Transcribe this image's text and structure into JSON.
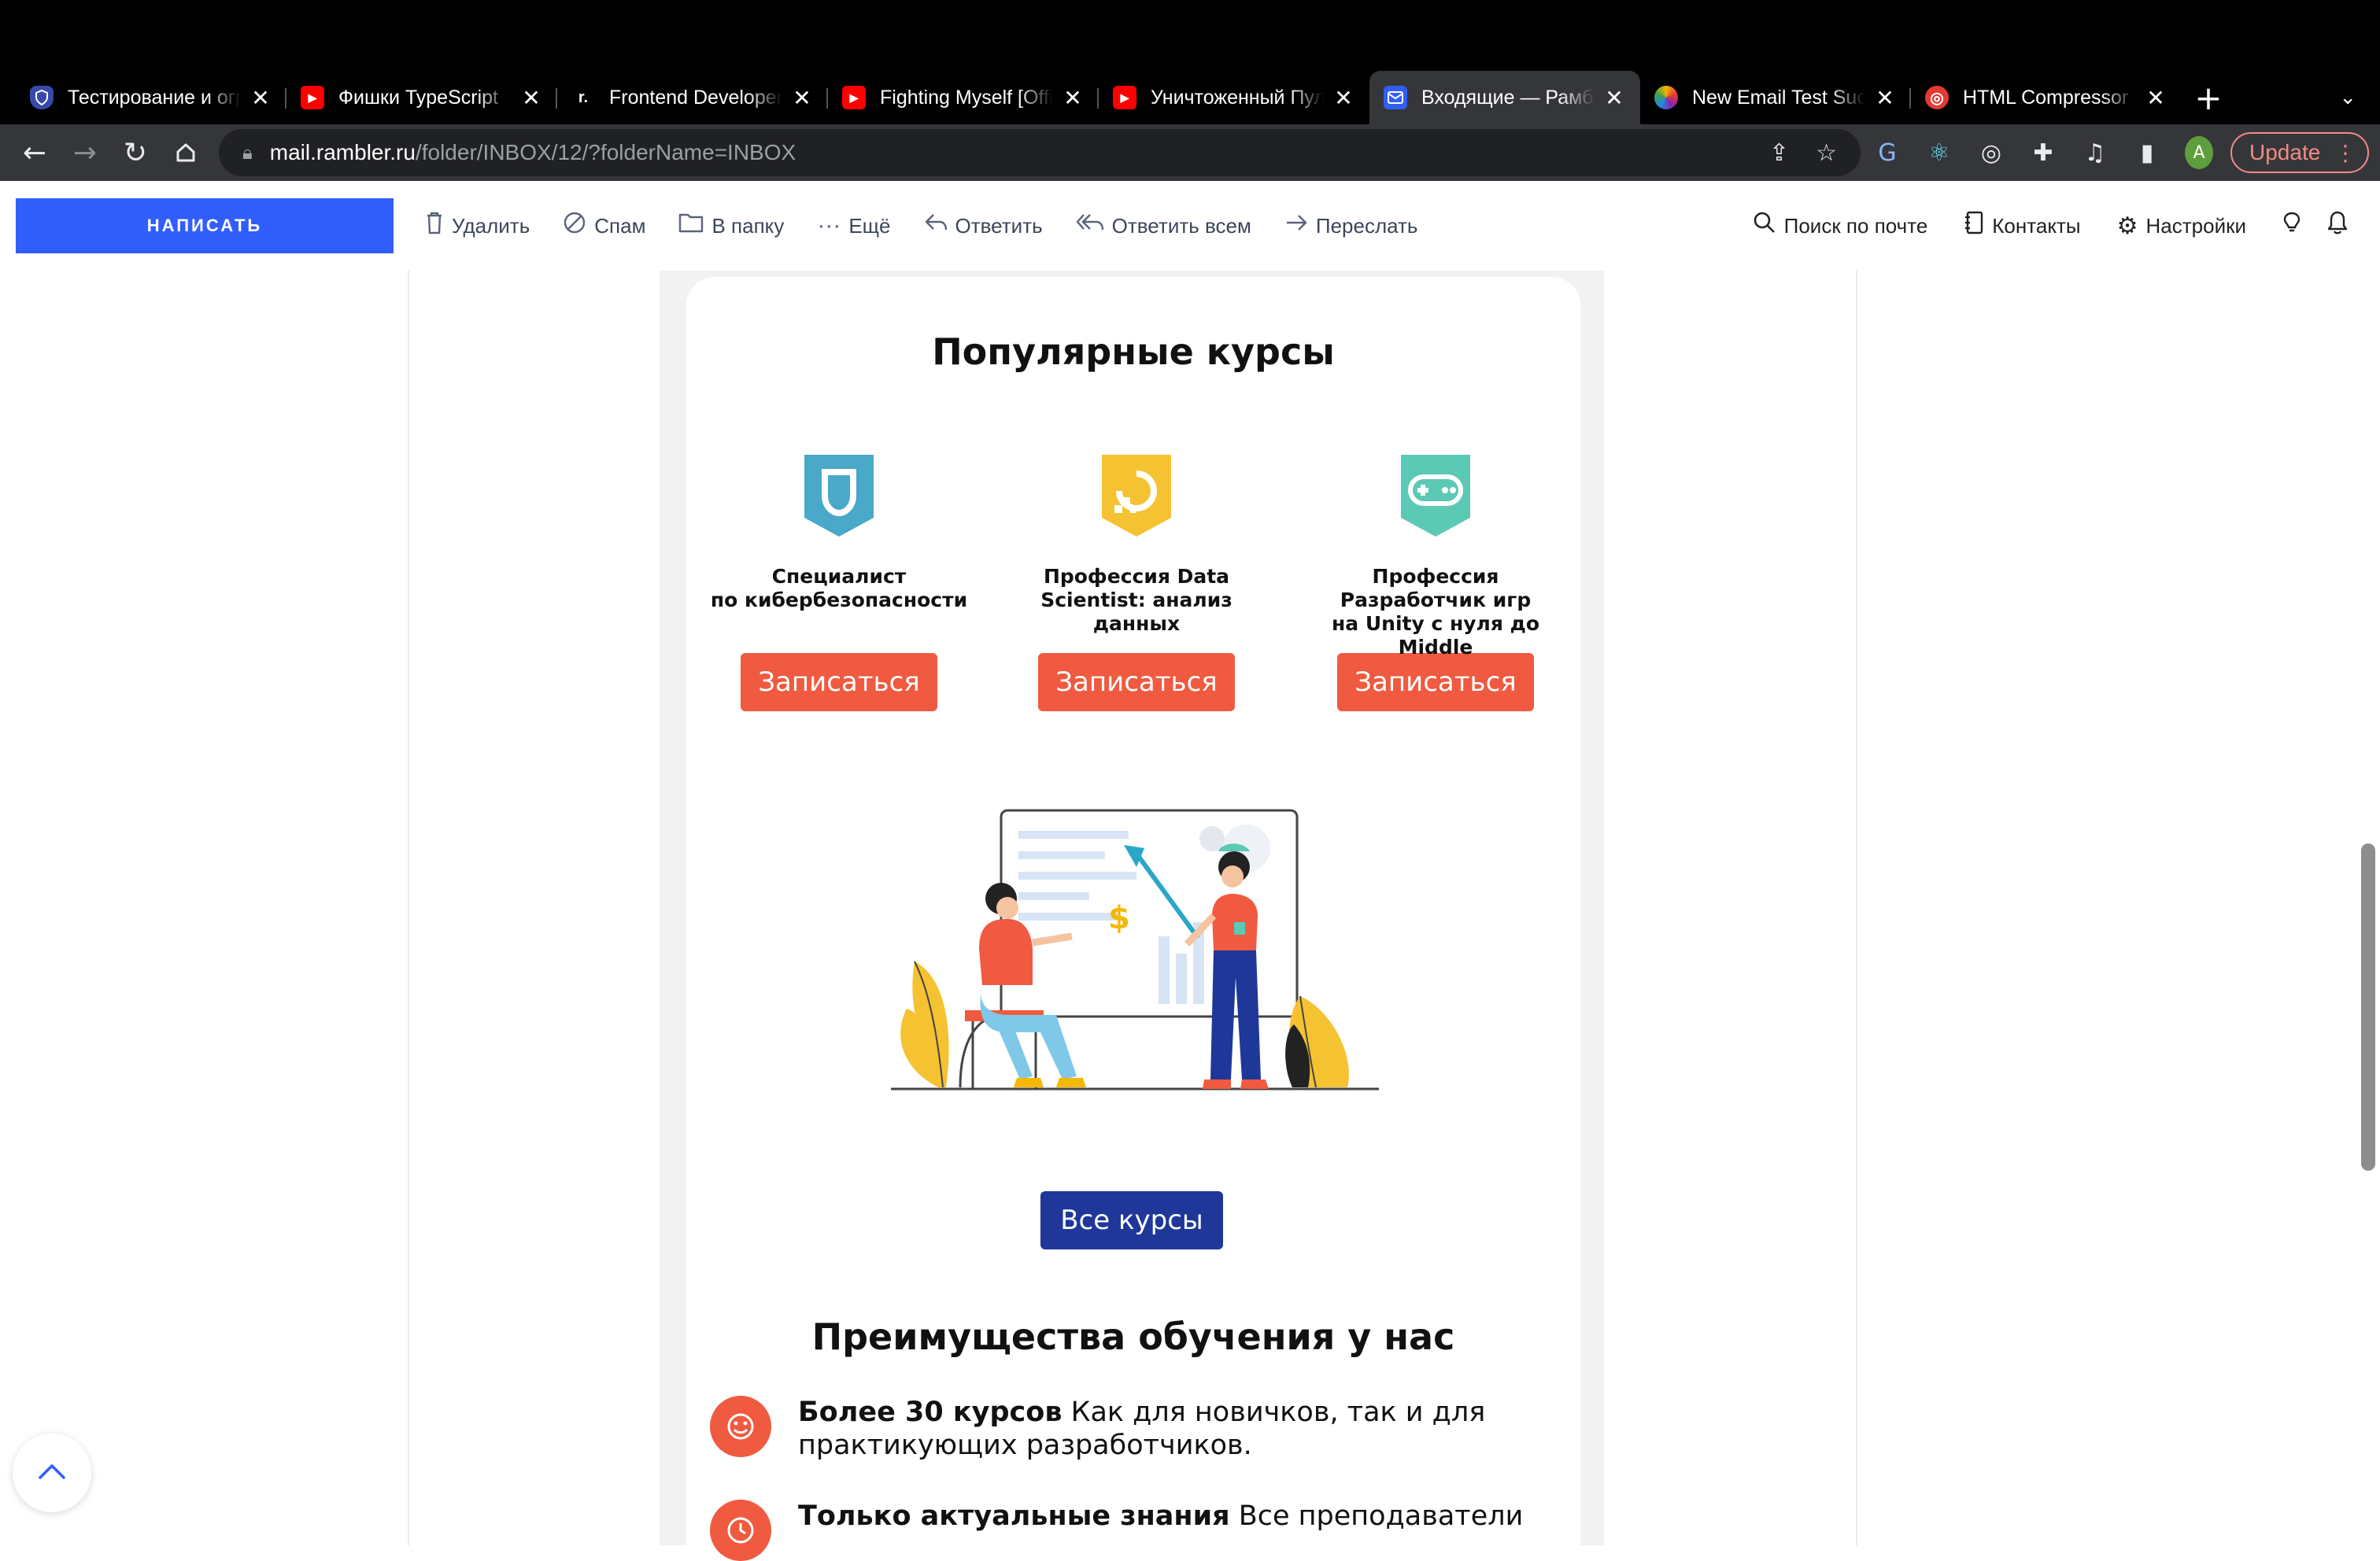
{
  "browser": {
    "tabs": [
      {
        "title": "Тестирование и ограничения",
        "favicon": "shield-icon"
      },
      {
        "title": "Фишки TypeScript",
        "favicon": "youtube-icon"
      },
      {
        "title": "Frontend Developer",
        "favicon": "r-icon"
      },
      {
        "title": "Fighting Myself [Official]",
        "favicon": "youtube-icon"
      },
      {
        "title": "Уничтоженный Пульт",
        "favicon": "youtube-icon"
      },
      {
        "title": "Входящие — Рамблер/почта",
        "favicon": "mail-icon",
        "active": true
      },
      {
        "title": "New Email Test Success",
        "favicon": "email-test-icon"
      },
      {
        "title": "HTML Compressor",
        "favicon": "html-compressor-icon"
      }
    ],
    "url_host": "mail.rambler.ru",
    "url_path": "/folder/INBOX/12/?folderName=INBOX",
    "profile_initial": "A",
    "update_label": "Update"
  },
  "toolbar": {
    "compose_label": "НАПИСАТЬ",
    "actions": [
      {
        "label": "Удалить",
        "icon": "trash-icon"
      },
      {
        "label": "Спам",
        "icon": "spam-icon"
      },
      {
        "label": "В папку",
        "icon": "folder-icon"
      },
      {
        "label": "Ещё",
        "icon": "more-icon"
      },
      {
        "label": "Ответить",
        "icon": "reply-icon"
      },
      {
        "label": "Ответить всем",
        "icon": "reply-all-icon"
      },
      {
        "label": "Переслать",
        "icon": "forward-icon"
      }
    ],
    "right": [
      {
        "label": "Поиск по почте",
        "icon": "search-icon"
      },
      {
        "label": "Контакты",
        "icon": "contacts-icon"
      },
      {
        "label": "Настройки",
        "icon": "gear-icon"
      }
    ]
  },
  "email": {
    "popular_title": "Популярные курсы",
    "courses": [
      {
        "name_line1": "Специалист",
        "name_line2": "по кибербезопасности",
        "name_line3": "",
        "button": "Записаться",
        "color": "#4aa8c8",
        "icon": "shield-badge-icon"
      },
      {
        "name_line1": "Профессия Data",
        "name_line2": "Scientist: анализ",
        "name_line3": "данных",
        "button": "Записаться",
        "color": "#f5c231",
        "icon": "data-badge-icon"
      },
      {
        "name_line1": "Профессия",
        "name_line2": "Разработчик игр",
        "name_line3": "на Unity с нуля до Middle",
        "button": "Записаться",
        "color": "#5cc9b5",
        "icon": "gamepad-badge-icon"
      }
    ],
    "all_courses_label": "Все курсы",
    "advantages_title": "Преимущества обучения у нас",
    "advantages": [
      {
        "bold": "Более 30 курсов",
        "text": " Как для новичков, так и для практикующих разработчиков.",
        "icon": "smile-icon"
      },
      {
        "bold": "Только актуальные знания",
        "text": " Все преподаватели",
        "icon": "clock-icon"
      }
    ]
  },
  "colors": {
    "accent": "#315efb",
    "enroll": "#f05a40",
    "all_courses": "#1e3799"
  }
}
